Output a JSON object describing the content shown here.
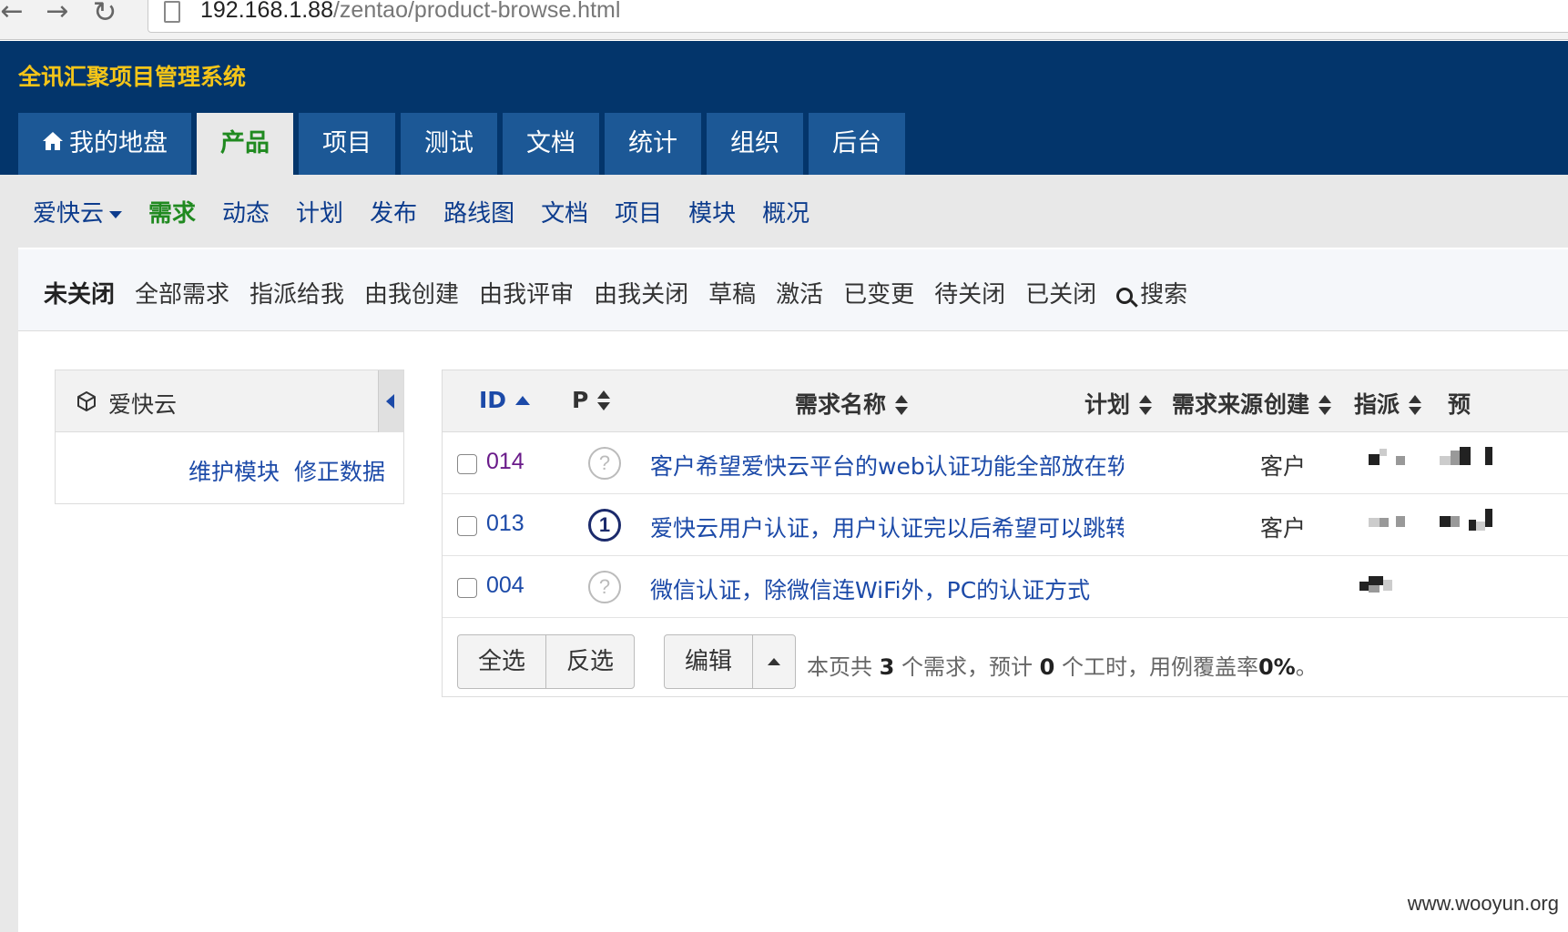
{
  "browser": {
    "back_icon": "arrow-left-icon",
    "forward_icon": "arrow-right-icon",
    "reload_icon": "reload-icon",
    "url_host": "192.168.1.88",
    "url_path": "/zentao/product-browse.html"
  },
  "app": {
    "title": "全讯汇聚项目管理系统"
  },
  "main_tabs": [
    {
      "label": "我的地盘",
      "icon": "home-icon"
    },
    {
      "label": "产品"
    },
    {
      "label": "项目"
    },
    {
      "label": "测试"
    },
    {
      "label": "文档"
    },
    {
      "label": "统计"
    },
    {
      "label": "组织"
    },
    {
      "label": "后台"
    }
  ],
  "sub_nav": {
    "product": "爱快云",
    "items": [
      "需求",
      "动态",
      "计划",
      "发布",
      "路线图",
      "文档",
      "项目",
      "模块",
      "概况"
    ]
  },
  "filters": {
    "items": [
      "未关闭",
      "全部需求",
      "指派给我",
      "由我创建",
      "由我评审",
      "由我关闭",
      "草稿",
      "激活",
      "已变更",
      "待关闭",
      "已关闭"
    ],
    "search_label": "搜索"
  },
  "module_panel": {
    "name": "爱快云",
    "link_maintain": "维护模块",
    "link_fix": "修正数据"
  },
  "table": {
    "headers": {
      "id": "ID",
      "pri": "P",
      "title": "需求名称",
      "plan": "计划",
      "source": "需求来源",
      "creator": "创建",
      "assigned": "指派",
      "estimate": "预"
    },
    "rows": [
      {
        "id": "014",
        "pri": "?",
        "title": "客户希望爱快云平台的web认证功能全部放在软",
        "source": "客户"
      },
      {
        "id": "013",
        "pri": "1",
        "title": "爱快云用户认证，用户认证完以后希望可以跳转",
        "source": "客户"
      },
      {
        "id": "004",
        "pri": "?",
        "title": "微信认证，除微信连WiFi外，PC的认证方式",
        "source": ""
      }
    ]
  },
  "footer": {
    "select_all": "全选",
    "invert": "反选",
    "edit": "编辑",
    "summary_prefix": "本页共",
    "count": "3",
    "summary_mid": "个需求，预计",
    "hours": "0",
    "summary_mid2": "个工时，用例覆盖率",
    "coverage": "0%",
    "summary_suffix": "。"
  },
  "watermark": "www.wooyun.org"
}
